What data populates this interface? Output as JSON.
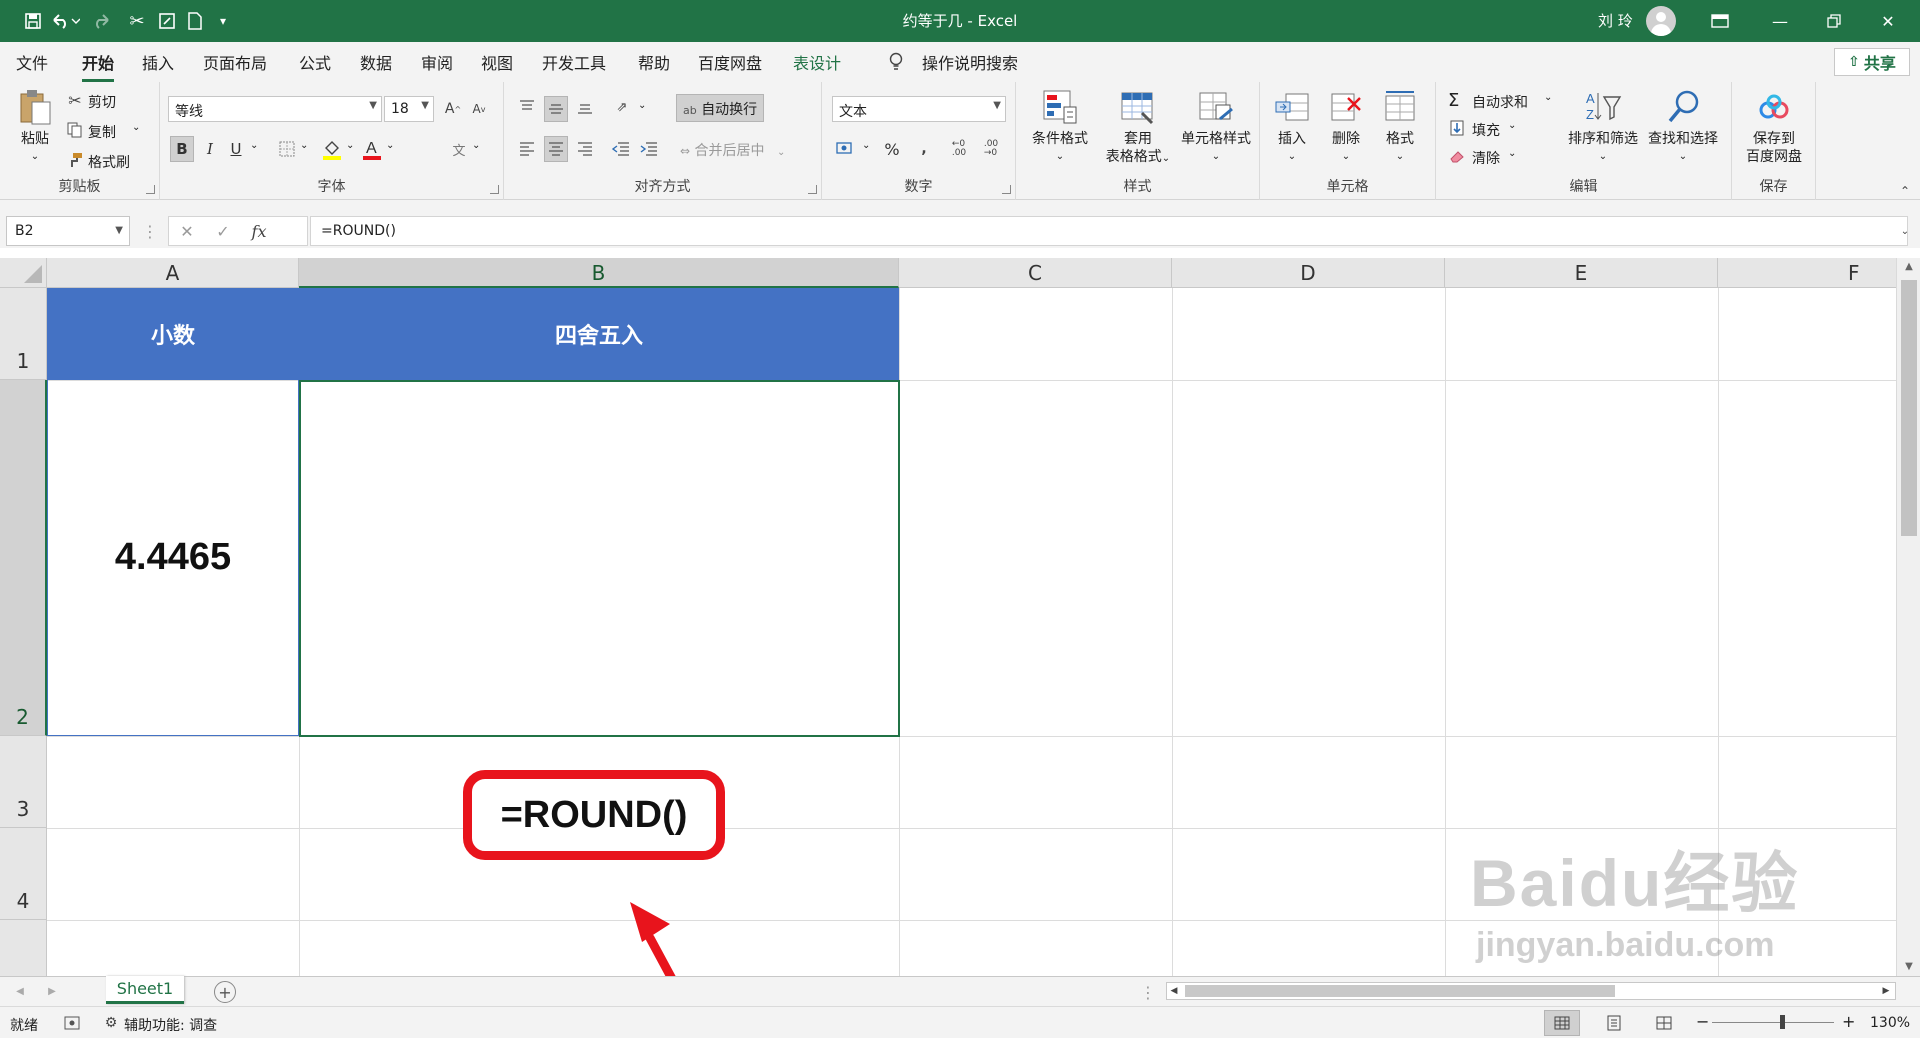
{
  "title_bar": {
    "title": "约等于几  -  Excel",
    "user": "刘 玲"
  },
  "tabs": [
    {
      "label": "文件"
    },
    {
      "label": "开始"
    },
    {
      "label": "插入"
    },
    {
      "label": "页面布局"
    },
    {
      "label": "公式"
    },
    {
      "label": "数据"
    },
    {
      "label": "审阅"
    },
    {
      "label": "视图"
    },
    {
      "label": "开发工具"
    },
    {
      "label": "帮助"
    },
    {
      "label": "百度网盘"
    },
    {
      "label": "表设计"
    }
  ],
  "tell_me": "操作说明搜索",
  "share": "共享",
  "ribbon": {
    "clipboard": {
      "paste": "粘贴",
      "cut": "剪切",
      "copy": "复制",
      "format_painter": "格式刷",
      "group": "剪贴板"
    },
    "font": {
      "font_name": "等线",
      "font_size": "18",
      "bold": "B",
      "italic": "I",
      "underline": "U",
      "group": "字体"
    },
    "alignment": {
      "wrap_text": "自动换行",
      "merge_center": "合并后居中",
      "group": "对齐方式"
    },
    "number": {
      "format": "文本",
      "percent": "%",
      "group": "数字"
    },
    "styles": {
      "conditional": "条件格式",
      "table_format_1": "套用",
      "table_format_2": "表格格式",
      "cell_styles": "单元格样式",
      "group": "样式"
    },
    "cells": {
      "insert": "插入",
      "delete": "删除",
      "format": "格式",
      "group": "单元格"
    },
    "editing": {
      "autosum": "自动求和",
      "fill": "填充",
      "clear": "清除",
      "sort_filter": "排序和筛选",
      "find_select": "查找和选择",
      "group": "编辑"
    },
    "save": {
      "save_1": "保存到",
      "save_2": "百度网盘",
      "group": "保存"
    }
  },
  "formula_bar": {
    "name_box": "B2",
    "formula": "=ROUND()"
  },
  "columns": [
    "A",
    "B",
    "C",
    "D",
    "E",
    "F"
  ],
  "rows": [
    "1",
    "2",
    "3",
    "4"
  ],
  "cells": {
    "a1": "小数",
    "b1": "四舍五入",
    "a2": "4.4465",
    "b2": "=ROUND()"
  },
  "sheet": {
    "name": "Sheet1"
  },
  "status": {
    "ready": "就绪",
    "accessibility": "辅助功能: 调查",
    "zoom": "130%"
  },
  "watermark": {
    "text": "Baidu经验",
    "url": "jingyan.baidu.com"
  },
  "colors": {
    "excel_green": "#217346",
    "header_fill": "#4472c4",
    "callout_red": "#e8141c"
  }
}
